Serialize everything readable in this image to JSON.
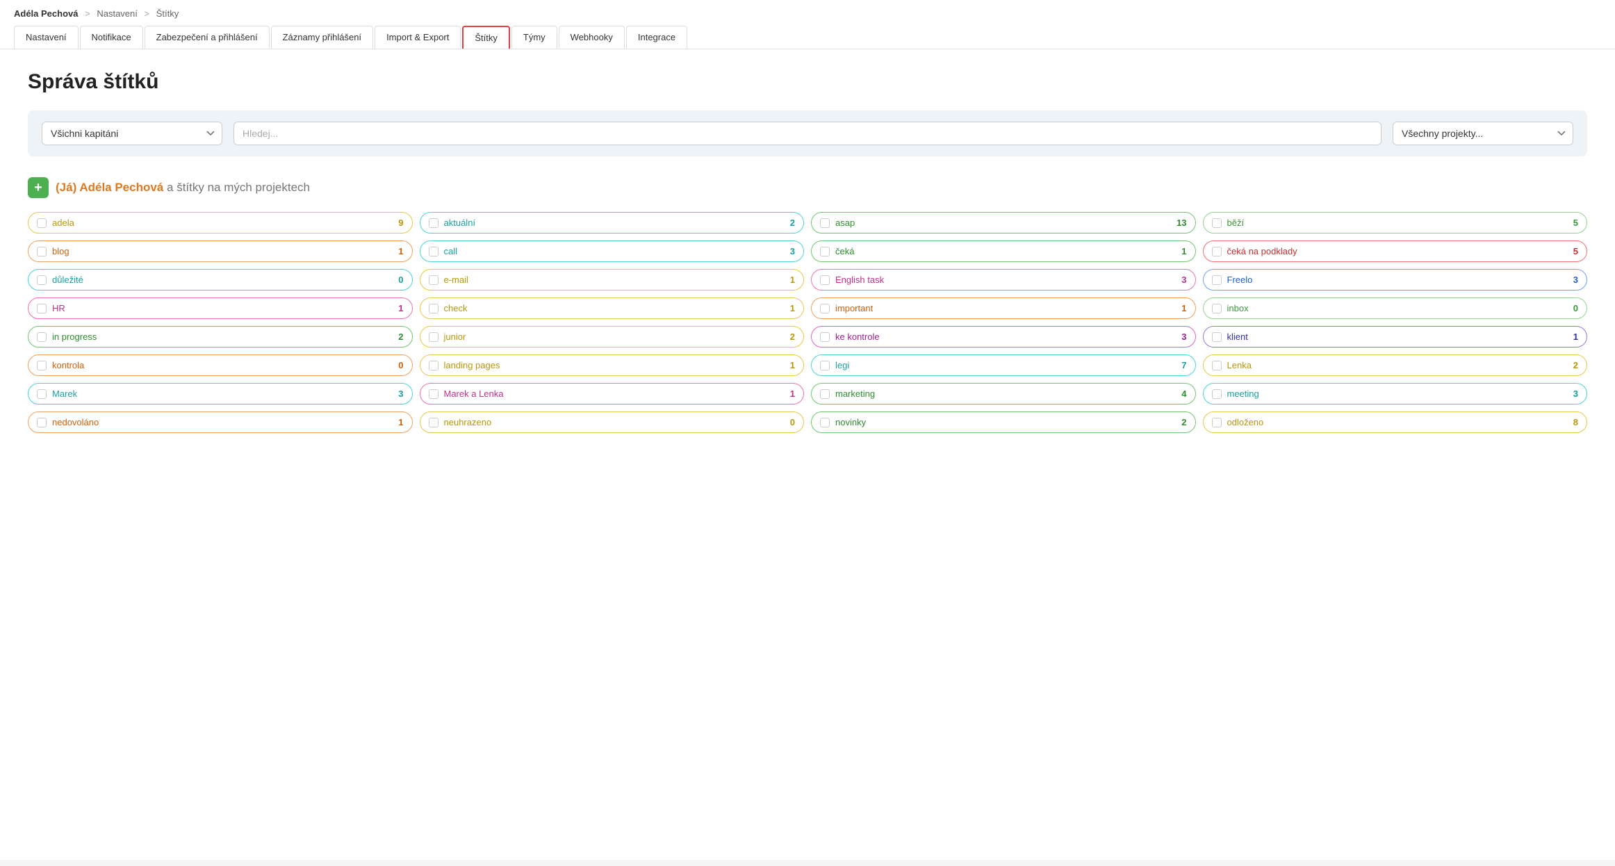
{
  "breadcrumb": {
    "user": "Adéla Pechová",
    "sep1": ">",
    "link1": "Nastavení",
    "sep2": ">",
    "current": "Štítky"
  },
  "tabs": [
    {
      "label": "Nastavení",
      "active": false
    },
    {
      "label": "Notifikace",
      "active": false
    },
    {
      "label": "Zabezpečení a přihlášení",
      "active": false
    },
    {
      "label": "Záznamy přihlášení",
      "active": false
    },
    {
      "label": "Import & Export",
      "active": false
    },
    {
      "label": "Štítky",
      "active": true
    },
    {
      "label": "Týmy",
      "active": false
    },
    {
      "label": "Webhooky",
      "active": false
    },
    {
      "label": "Integrace",
      "active": false
    }
  ],
  "page_title": "Správa štítků",
  "filter": {
    "captain_placeholder": "Všichni kapitáni",
    "captain_value": "Všichni kapitáni",
    "search_placeholder": "Hledej...",
    "project_placeholder": "Všechny projekty...",
    "project_value": "Všechny projekty..."
  },
  "section": {
    "add_label": "+",
    "title_name": "(Já) Adéla Pechová",
    "title_suffix": " a štítky na mých projektech"
  },
  "labels": [
    {
      "name": "adela",
      "count": "9",
      "color": "yellow"
    },
    {
      "name": "aktuální",
      "count": "2",
      "color": "teal"
    },
    {
      "name": "asap",
      "count": "13",
      "color": "green"
    },
    {
      "name": "běží",
      "count": "5",
      "color": "lightgreen"
    },
    {
      "name": "blog",
      "count": "1",
      "color": "orange"
    },
    {
      "name": "call",
      "count": "3",
      "color": "teal"
    },
    {
      "name": "čeká",
      "count": "1",
      "color": "green"
    },
    {
      "name": "čeká na podklady",
      "count": "5",
      "color": "red"
    },
    {
      "name": "důležité",
      "count": "0",
      "color": "teal"
    },
    {
      "name": "e-mail",
      "count": "1",
      "color": "yellow"
    },
    {
      "name": "English task",
      "count": "3",
      "color": "pink"
    },
    {
      "name": "Freelo",
      "count": "3",
      "color": "blue"
    },
    {
      "name": "HR",
      "count": "1",
      "color": "pink"
    },
    {
      "name": "check",
      "count": "1",
      "color": "yellow"
    },
    {
      "name": "important",
      "count": "1",
      "color": "orange"
    },
    {
      "name": "inbox",
      "count": "0",
      "color": "lightgreen"
    },
    {
      "name": "in progress",
      "count": "2",
      "color": "green"
    },
    {
      "name": "junior",
      "count": "2",
      "color": "yellow"
    },
    {
      "name": "ke kontrole",
      "count": "3",
      "color": "magenta"
    },
    {
      "name": "klient",
      "count": "1",
      "color": "indigo"
    },
    {
      "name": "kontrola",
      "count": "0",
      "color": "orange"
    },
    {
      "name": "landing pages",
      "count": "1",
      "color": "yellow"
    },
    {
      "name": "legi",
      "count": "7",
      "color": "teal"
    },
    {
      "name": "Lenka",
      "count": "2",
      "color": "yellow"
    },
    {
      "name": "Marek",
      "count": "3",
      "color": "teal"
    },
    {
      "name": "Marek a Lenka",
      "count": "1",
      "color": "pink"
    },
    {
      "name": "marketing",
      "count": "4",
      "color": "green"
    },
    {
      "name": "meeting",
      "count": "3",
      "color": "teal"
    },
    {
      "name": "nedovoláno",
      "count": "1",
      "color": "orange"
    },
    {
      "name": "neuhrazeno",
      "count": "0",
      "color": "yellow"
    },
    {
      "name": "novinky",
      "count": "2",
      "color": "green"
    },
    {
      "name": "odloženo",
      "count": "8",
      "color": "yellow"
    }
  ]
}
